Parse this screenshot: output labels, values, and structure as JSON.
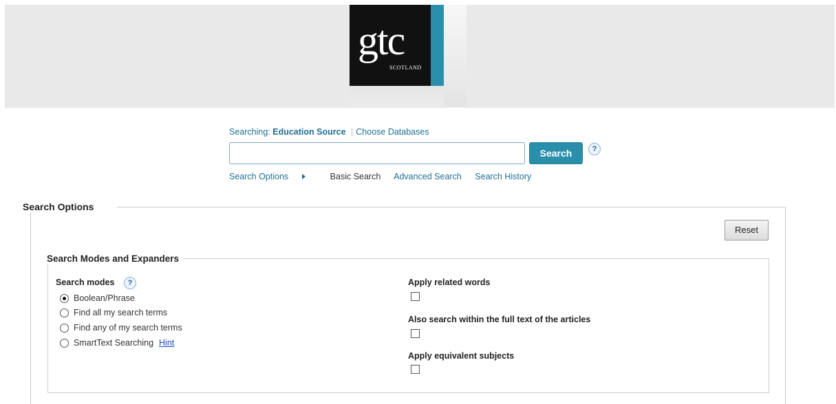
{
  "header": {
    "logo_text": "gtc",
    "logo_subtext": "SCOTLAND"
  },
  "search": {
    "searching_label": "Searching:",
    "database": "Education Source",
    "choose_databases": "Choose Databases",
    "input_value": "",
    "button_label": "Search",
    "help": "?"
  },
  "nav": {
    "search_options": "Search Options",
    "basic_search": "Basic Search",
    "advanced_search": "Advanced Search",
    "search_history": "Search History"
  },
  "options": {
    "title": "Search Options",
    "reset_label": "Reset",
    "modes_section_title": "Search Modes and Expanders",
    "search_modes_label": "Search modes",
    "search_modes_help": "?",
    "modes": [
      {
        "label": "Boolean/Phrase",
        "selected": true
      },
      {
        "label": "Find all my search terms",
        "selected": false
      },
      {
        "label": "Find any of my search terms",
        "selected": false
      },
      {
        "label": "SmartText Searching",
        "selected": false
      }
    ],
    "hint_label": "Hint",
    "expanders": [
      {
        "label": "Apply related words",
        "checked": false
      },
      {
        "label": "Also search within the full text of the articles",
        "checked": false
      },
      {
        "label": "Apply equivalent subjects",
        "checked": false
      }
    ]
  },
  "colors": {
    "accent": "#2a8fab",
    "link": "#1f6f93",
    "banner_bg": "#e9e9e9"
  }
}
